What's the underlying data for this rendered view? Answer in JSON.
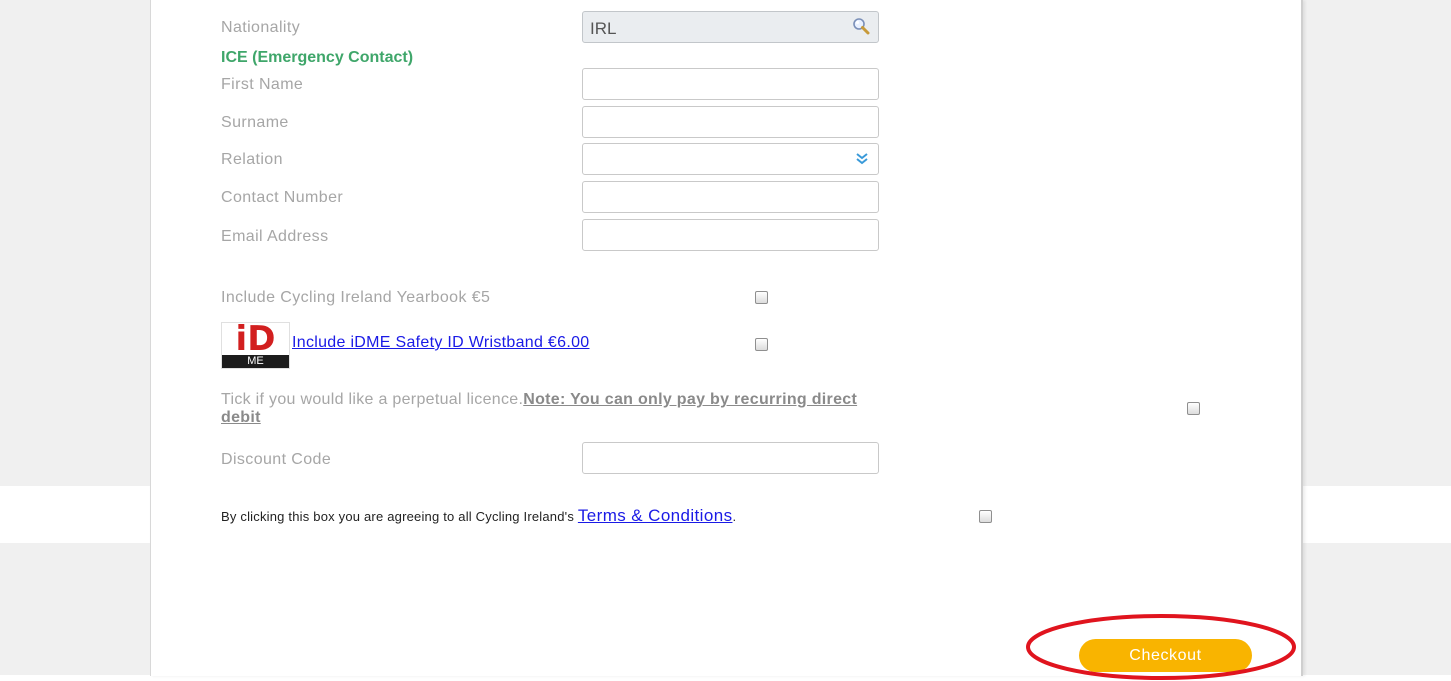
{
  "form": {
    "nationality": {
      "label": "Nationality",
      "value": "IRL"
    },
    "ice_heading": "ICE (Emergency Contact)",
    "first_name": {
      "label": "First Name",
      "value": ""
    },
    "surname": {
      "label": "Surname",
      "value": ""
    },
    "relation": {
      "label": "Relation",
      "value": ""
    },
    "contact_number": {
      "label": "Contact Number",
      "value": ""
    },
    "email": {
      "label": "Email Address",
      "value": ""
    },
    "yearbook_label": "Include Cycling Ireland Yearbook €5",
    "idme": {
      "logo_text_top": "iD",
      "logo_text_bottom": "ME",
      "link_label": "Include iDME Safety ID Wristband €6.00"
    },
    "perpetual": {
      "text": "Tick if you would like a perpetual licence.",
      "note_line1": "Note: You can only pay by recurring direct",
      "note_line2": "debit"
    },
    "discount_code": {
      "label": "Discount Code",
      "value": ""
    },
    "terms": {
      "prefix": "By clicking this box you are agreeing to all Cycling Ireland's ",
      "link": "Terms & Conditions",
      "suffix": "."
    },
    "checkout_label": "Checkout"
  },
  "icons": {
    "nationality": "search-icon",
    "relation": "chevron-double-down-icon"
  },
  "colors": {
    "accent_green": "#3fa66a",
    "checkout_button": "#f9b400",
    "link": "#1a1ae6",
    "highlight_ring": "#e0141e",
    "chevron": "#3a9ad9"
  }
}
